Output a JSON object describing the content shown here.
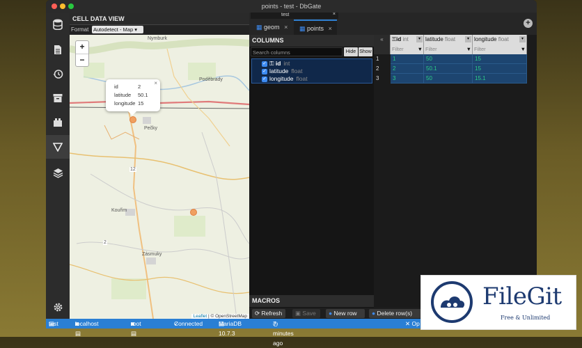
{
  "window": {
    "title": "points - test - DbGate"
  },
  "sidebar": {
    "icons": [
      "database-icon",
      "file-icon",
      "history-icon",
      "archive-icon",
      "plugin-icon",
      "filter-icon",
      "layers-icon",
      "settings-icon"
    ]
  },
  "cell_view": {
    "title": "CELL DATA VIEW",
    "format_label": "Format",
    "format_value": "Autodetect - Map ▾"
  },
  "map": {
    "zoom_in": "+",
    "zoom_out": "−",
    "popup": {
      "rows": [
        {
          "k": "id",
          "v": "2"
        },
        {
          "k": "latitude",
          "v": "50.1"
        },
        {
          "k": "longitude",
          "v": "15"
        }
      ],
      "close": "×"
    },
    "labels": [
      "Nymburk",
      "Poděbrady",
      "Pečky",
      "Kouřim",
      "Zásmuky",
      "12",
      "2"
    ],
    "attribution_leaflet": "Leaflet",
    "attribution_rest": " | © OpenStreetMap"
  },
  "tabs": {
    "strip_label": "test",
    "items": [
      {
        "label": "geom"
      },
      {
        "label": "points"
      }
    ],
    "add": "+"
  },
  "columns": {
    "title": "COLUMNS",
    "search_placeholder": "Search columns",
    "hide": "Hide",
    "show": "Show",
    "items": [
      {
        "name": "id",
        "type": "int"
      },
      {
        "name": "latitude",
        "type": "float"
      },
      {
        "name": "longitude",
        "type": "float"
      }
    ]
  },
  "macros": {
    "title": "MACROS"
  },
  "grid": {
    "collapse": "«",
    "headers": [
      {
        "name": "id",
        "type": "int"
      },
      {
        "name": "latitude",
        "type": "float"
      },
      {
        "name": "longitude",
        "type": "float"
      }
    ],
    "filter_placeholder": "Filter",
    "rows": [
      {
        "num": "1",
        "cells": [
          "1",
          "50",
          "15"
        ]
      },
      {
        "num": "2",
        "cells": [
          "2",
          "50.1",
          "15"
        ]
      },
      {
        "num": "3",
        "cells": [
          "3",
          "50",
          "15.1"
        ]
      }
    ]
  },
  "toolbar": {
    "refresh": "Refresh",
    "save": "Save",
    "new_row": "New row",
    "delete_row": "Delete row(s)"
  },
  "status": {
    "db": "test",
    "server": "localhost",
    "user": "root",
    "connection": "Connected",
    "version": "MariaDB 10.7.3",
    "time": "7 minutes ago",
    "close": "✕ Op"
  },
  "watermark": {
    "name": "FileGit",
    "tagline": "Free & Unlimited"
  },
  "colors": {
    "accent": "#2a7fd4",
    "selection": "#1d4570",
    "cell_text": "#2ccc88"
  }
}
